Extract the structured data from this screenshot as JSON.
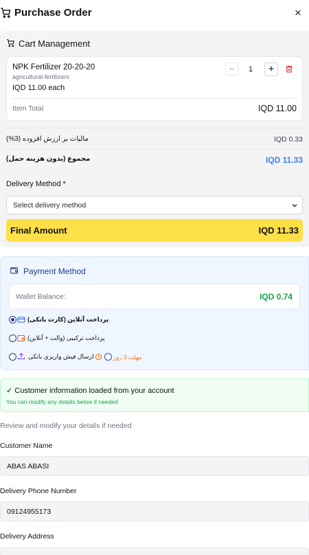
{
  "header": {
    "title": "Purchase Order",
    "close": "×"
  },
  "cart": {
    "title": "Cart Management",
    "item": {
      "name": "NPK Fertilizer 20-20-20",
      "category": "agricultural-fertilizers",
      "unit_price": "IQD 11.00 each",
      "quantity": "1",
      "minus": "−",
      "plus": "+",
      "total_label": "Item Total",
      "total_value": "IQD 11.00"
    },
    "vat_label": "مالیات بر ارزش افزوده (3%)",
    "vat_value": "IQD 0.33",
    "subtotal_label": "مجموع (بدون هزینه حمل)",
    "subtotal_value": "IQD 11.33",
    "delivery_label": "Delivery Method *",
    "delivery_placeholder": "Select delivery method",
    "final_label": "Final Amount",
    "final_value": "IQD 11.33"
  },
  "payment": {
    "title": "Payment Method",
    "wallet_label": "Wallet Balance:",
    "wallet_value": "IQD 0.74",
    "options": [
      {
        "label": "پرداخت آنلاین (کارت بانکی)",
        "icon": "credit-card-icon",
        "selected": true
      },
      {
        "label": "پرداخت ترکیبی (والت + آنلاین)",
        "icon": "wallet-icon",
        "selected": false
      },
      {
        "label": "ارسال فیش واریزی بانکی",
        "icon": "upload-icon",
        "selected": false,
        "deadline": "مهلت 3 روز"
      }
    ]
  },
  "customer": {
    "info_title": "✓ Customer information loaded from your account",
    "info_sub": "You can modify any details below if needed",
    "review_text": "Review and modify your details if needed",
    "name_label": "Customer Name",
    "name_value": "ABAS ABASI",
    "phone_label": "Delivery Phone Number",
    "phone_value": "09124955173",
    "address_label": "Delivery Address"
  },
  "colors": {
    "accent_blue": "#3b82f6",
    "final_yellow": "#fde047",
    "success_green": "#16a34a",
    "danger_red": "#dc2626",
    "deadline_orange": "#f97316"
  }
}
